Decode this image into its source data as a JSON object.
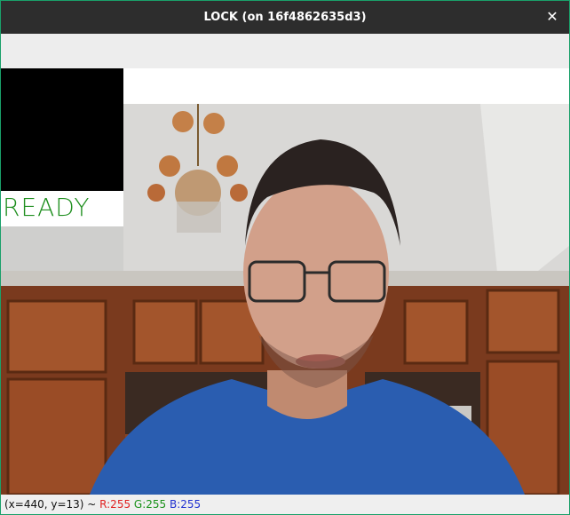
{
  "window": {
    "title": "LOCK (on 16f4862635d3)",
    "close_glyph": "✕"
  },
  "overlay": {
    "status_text": "READY"
  },
  "statusbar": {
    "coords": "(x=440, y=13) ~ ",
    "r": "R:255",
    "g": "G:255",
    "b": "B:255"
  },
  "colors": {
    "title_bg": "#2d2d2d",
    "frame_border": "#1aa06a",
    "ready_text": "#1f8f1f",
    "r": "#e02020",
    "g": "#189018",
    "b": "#2030d0"
  }
}
